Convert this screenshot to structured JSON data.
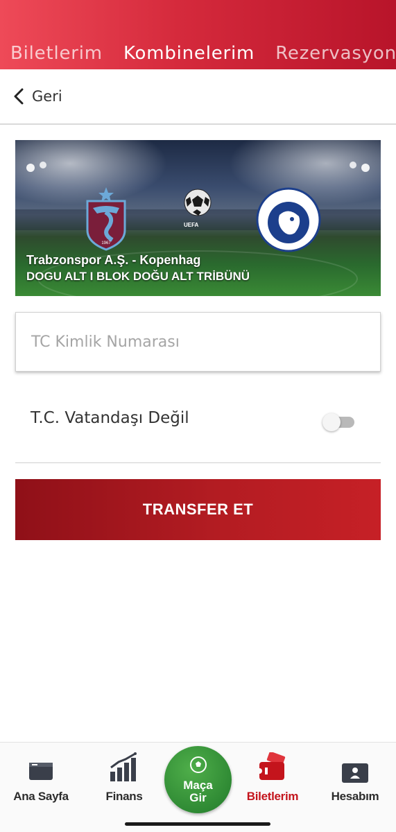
{
  "header": {
    "tabs": [
      {
        "label": "Biletlerim"
      },
      {
        "label": "Kombinelerim"
      },
      {
        "label": "Rezervasyonları"
      }
    ]
  },
  "back": {
    "label": "Geri",
    "icon": "chevron-left-icon"
  },
  "match": {
    "title": "Trabzonspor A.Ş. - Kopenhag",
    "section": "DOGU ALT I BLOK DOĞU ALT TRİBÜNÜ",
    "home_crest_year": "1967",
    "away_crest_text": "F.C. KØBENHAVN",
    "organizer_text": "UEFA"
  },
  "form": {
    "tc_placeholder": "TC Kimlik Numarası",
    "tc_value": "",
    "citizen_toggle_label": "T.C. Vatandaşı Değil",
    "citizen_toggle_on": false
  },
  "transfer_button": {
    "label": "TRANSFER ET"
  },
  "bottom_nav": {
    "items": [
      {
        "label": "Ana Sayfa",
        "icon": "ticket-card-icon"
      },
      {
        "label": "Finans",
        "icon": "bar-chart-icon"
      },
      {
        "label": "Biletlerim",
        "icon": "ticket-icon",
        "active": true
      },
      {
        "label": "Hesabım",
        "icon": "id-card-icon"
      }
    ],
    "center": {
      "line1": "Maça",
      "line2": "Gir",
      "icon": "soccer-ball-icon"
    }
  },
  "colors": {
    "accent": "#c4141c",
    "header_gradient_start": "#ee4a58",
    "header_gradient_end": "#b8142a",
    "center_button": "#2f8a34"
  }
}
